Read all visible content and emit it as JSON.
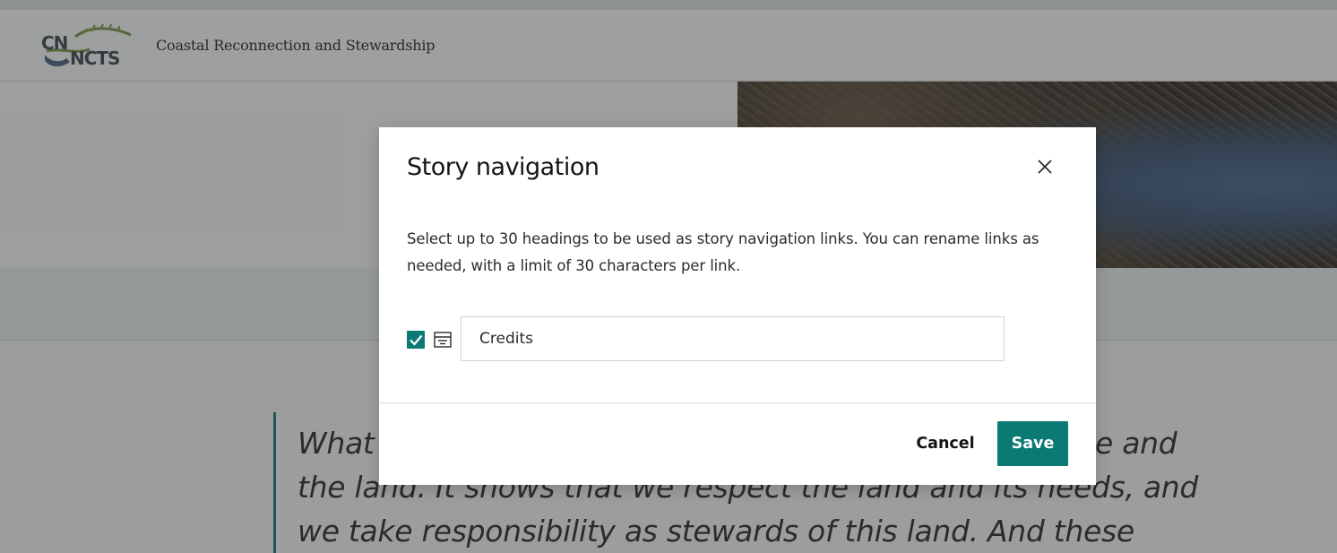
{
  "site": {
    "logo_text": "CNNCTS",
    "title": "Coastal Reconnection and Stewardship"
  },
  "story": {
    "quote_lines": [
      "What",
      "the land. It shows that we respect the land and its needs, and",
      "we take responsibility as stewards of this land. And these"
    ],
    "quote_line1_right": "e and"
  },
  "modal": {
    "title": "Story navigation",
    "description": "Select up to 30 headings to be used as story navigation links. You can rename links as needed, with a limit of 30 characters per link.",
    "items": [
      {
        "checked": true,
        "icon": "heading-icon",
        "value": "Credits"
      }
    ],
    "cancel_label": "Cancel",
    "save_label": "Save"
  },
  "colors": {
    "accent": "#0b7a75",
    "quote_bar": "#0c6a6d",
    "overlay": "rgba(60,63,63,0.48)"
  },
  "icons": {
    "close": "close-icon",
    "checkbox": "check-icon",
    "heading": "heading-icon"
  }
}
